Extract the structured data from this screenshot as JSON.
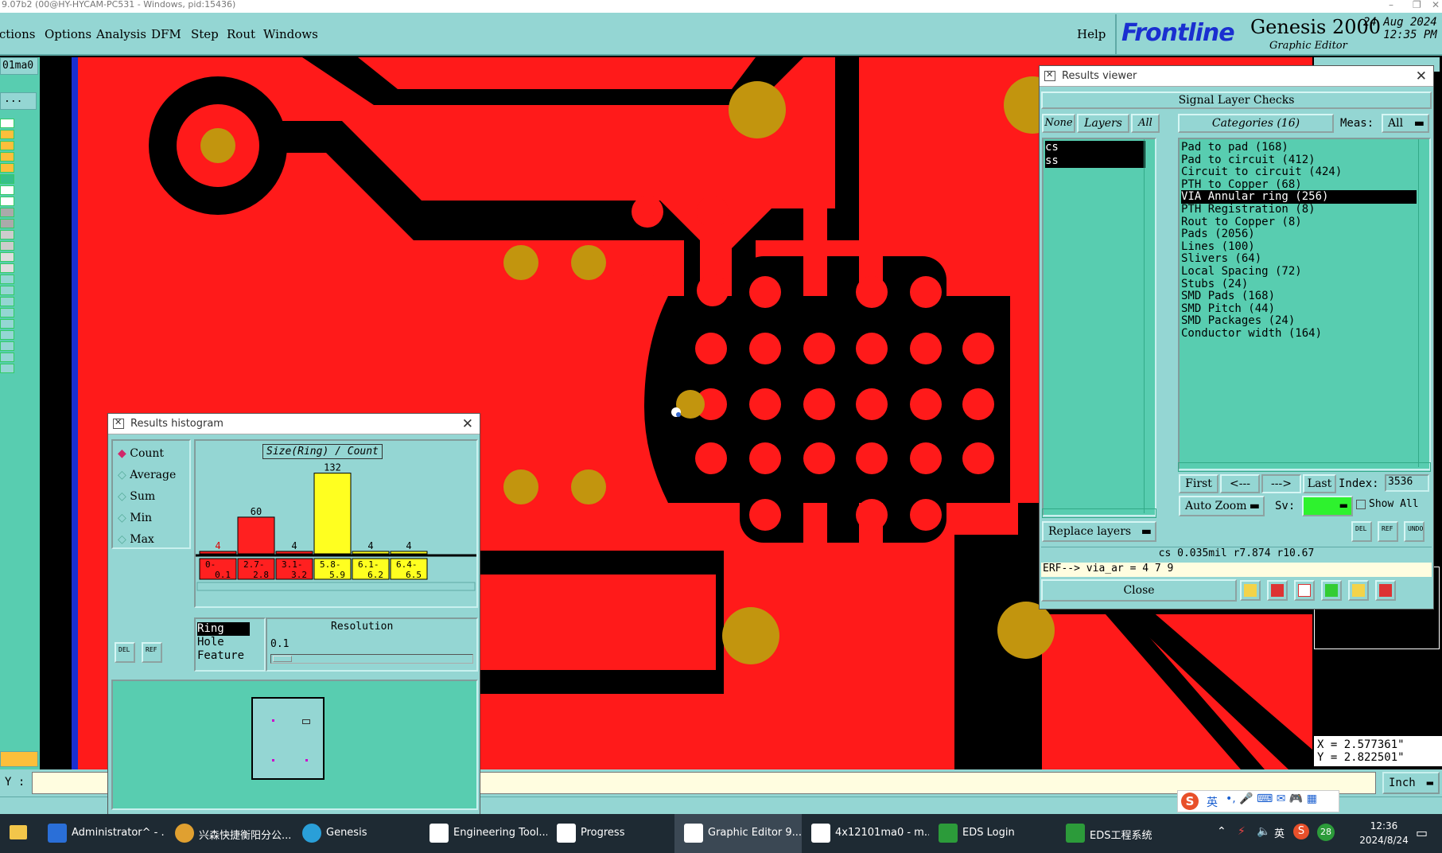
{
  "titlebar": {
    "text": "9.07b2 (00@HY-HYCAM-PC531 - Windows, pid:15436)"
  },
  "menubar": {
    "items": [
      "Actions",
      "Options",
      "Analysis",
      "DFM",
      "Step",
      "Rout",
      "Windows"
    ],
    "help": "Help"
  },
  "logo": {
    "brand": "Frontline",
    "product": "Genesis 2000",
    "subtitle": "Graphic Editor",
    "date": "24 Aug 2024",
    "time": "12:35 PM"
  },
  "left": {
    "job": "01ma0",
    "dots": "..."
  },
  "histogram": {
    "title": "Results histogram",
    "modes": [
      "Count",
      "Average",
      "Sum",
      "Min",
      "Max"
    ],
    "selected_mode": "Count",
    "chart_title": "Size(Ring) / Count",
    "attributes": [
      "Ring",
      "Hole",
      "Feature"
    ],
    "selected_attribute": "Ring",
    "resolution_label": "Resolution",
    "resolution_value": "0.1",
    "chart_data": {
      "type": "bar",
      "title": "Size(Ring) / Count",
      "categories": [
        "0-0.1",
        "2.7-2.8",
        "3.1-3.2",
        "5.8-5.9",
        "6.1-6.2",
        "6.4-6.5"
      ],
      "values": [
        4,
        60,
        4,
        132,
        4,
        4
      ],
      "colors": [
        "#ff2020",
        "#ff2020",
        "#ff2020",
        "#ffff20",
        "#ffff20",
        "#ffff20"
      ],
      "xlabel": "",
      "ylabel": "",
      "ylim": [
        0,
        140
      ],
      "grid": false,
      "legend": "none"
    }
  },
  "results_viewer": {
    "title": "Results viewer",
    "header": "Signal Layer Checks",
    "none_btn": "None",
    "layers_btn": "Layers",
    "all_btn": "All",
    "categories_btn": "Categories (16)",
    "meas_label": "Meas:",
    "meas_value": "All",
    "layers": [
      "cs",
      "ss"
    ],
    "categories": [
      "Pad to pad (168)",
      "Pad to circuit (412)",
      "Circuit to circuit (424)",
      "PTH to Copper (68)",
      "VIA Annular ring (256)",
      "PTH Registration (8)",
      "Rout to Copper (8)",
      "Pads (2056)",
      "Lines (100)",
      "Slivers (64)",
      "Local Spacing (72)",
      "Stubs (24)",
      "SMD Pads (168)",
      "SMD Pitch (44)",
      "SMD Packages (24)",
      "Conductor width (164)"
    ],
    "selected_category": "VIA Annular ring (256)",
    "first": "First",
    "prev": "<---",
    "next": "--->",
    "last": "Last",
    "index_label": "Index:",
    "index_value": "3536",
    "zoom_value": "Auto Zoom",
    "sv_label": "Sv:",
    "show_all": "Show All",
    "replace_layers": "Replace layers",
    "status": "cs 0.035mil  r7.874  r10.67",
    "erf": "ERF--> via_ar = 4 7 9",
    "close": "Close"
  },
  "coords": {
    "x": "X = 2.577361\"",
    "y": "Y = 2.822501\""
  },
  "cmd": {
    "label": "Y :",
    "units": "Inch"
  },
  "taskbar": {
    "items": [
      "Administrator^ - ...",
      "兴森快捷衡阳分公...",
      "Genesis",
      "Engineering Tool...",
      "Progress",
      "Graphic Editor 9....",
      "4x12101ma0 - m...",
      "EDS Login",
      "EDS工程系统"
    ],
    "active": "Graphic Editor 9....",
    "tray_lang": "英",
    "tray_badge": "28",
    "clock_time": "12:36",
    "clock_date": "2024/8/24"
  },
  "ime": {
    "lang": "英"
  }
}
